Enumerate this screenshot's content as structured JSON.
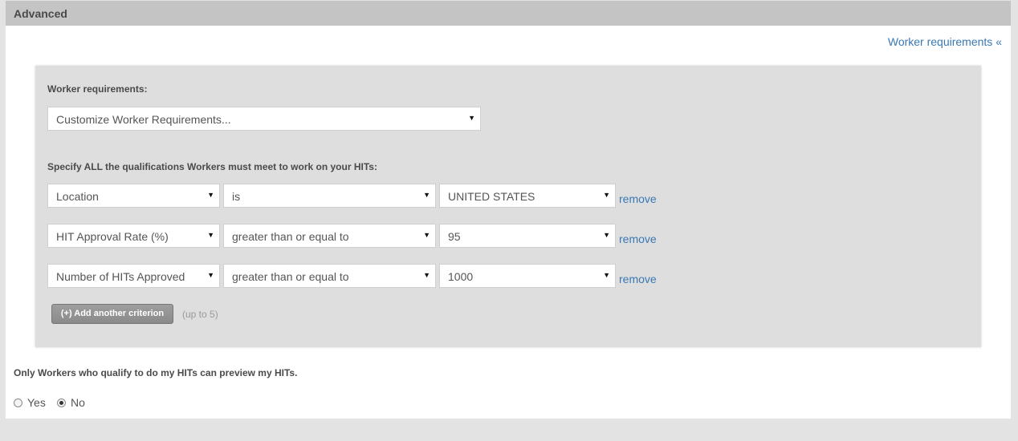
{
  "panel": {
    "title": "Advanced",
    "toggle_link": "Worker requirements «"
  },
  "requirements": {
    "label": "Worker requirements:",
    "preset_select": "Customize Worker Requirements...",
    "spec_label": "Specify ALL the qualifications Workers must meet to work on your HITs:",
    "criteria": [
      {
        "qualification": "Location",
        "comparator": "is",
        "value": "UNITED STATES",
        "remove": "remove"
      },
      {
        "qualification": "HIT Approval Rate (%)",
        "comparator": "greater than or equal to",
        "value": "95",
        "remove": "remove"
      },
      {
        "qualification": "Number of HITs Approved",
        "comparator": "greater than or equal to",
        "value": "1000",
        "remove": "remove"
      }
    ],
    "add_button": "(+) Add another criterion",
    "add_hint": "(up to 5)"
  },
  "preview": {
    "question": "Only Workers who qualify to do my HITs can preview my HITs.",
    "options": [
      {
        "label": "Yes",
        "selected": false
      },
      {
        "label": "No",
        "selected": true
      }
    ]
  },
  "icons": {
    "dropdown": "chevron-down-icon",
    "radio": "radio-icon"
  },
  "colors": {
    "link": "#3a78b3",
    "header_bg": "#c4c4c4",
    "box_bg": "#dedede"
  }
}
